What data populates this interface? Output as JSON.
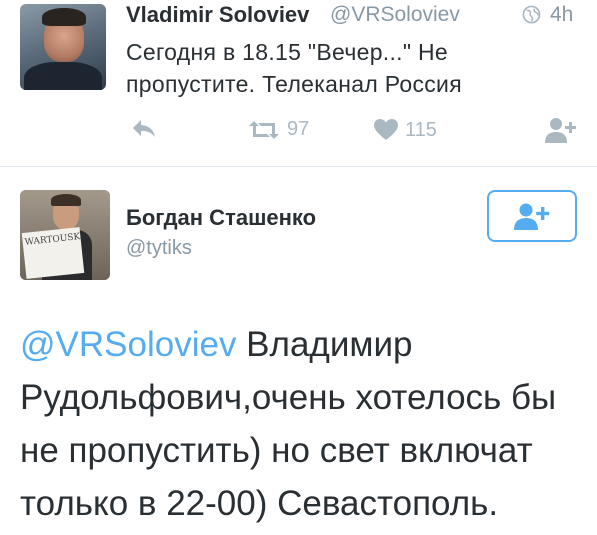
{
  "tweet": {
    "author_name": "Vladimir Soloviev",
    "author_handle": "@VRSoloviev",
    "time": "4h",
    "text": "Сегодня в 18.15 \"Вечер...\" Не пропустите. Телеканал Россия",
    "retweets": "97",
    "likes": "115",
    "icons": {
      "globe": "globe-icon",
      "reply": "reply-icon",
      "retweet": "retweet-icon",
      "like": "heart-icon",
      "follow": "follow-icon"
    }
  },
  "reply": {
    "author_name": "Богдан Сташенко",
    "author_handle": "@tytiks",
    "mention": "@VRSoloviev",
    "text": " Владимир Рудольфович,очень хотелось бы не пропустить) но свет включат только в 22-00) Севастополь.",
    "avatar_sign_text": "WARTOUSK"
  },
  "colors": {
    "accent": "#55acee",
    "muted": "#8899a6",
    "icon": "#aab8c2",
    "text": "#292f33",
    "divider": "#e1e8ed"
  }
}
